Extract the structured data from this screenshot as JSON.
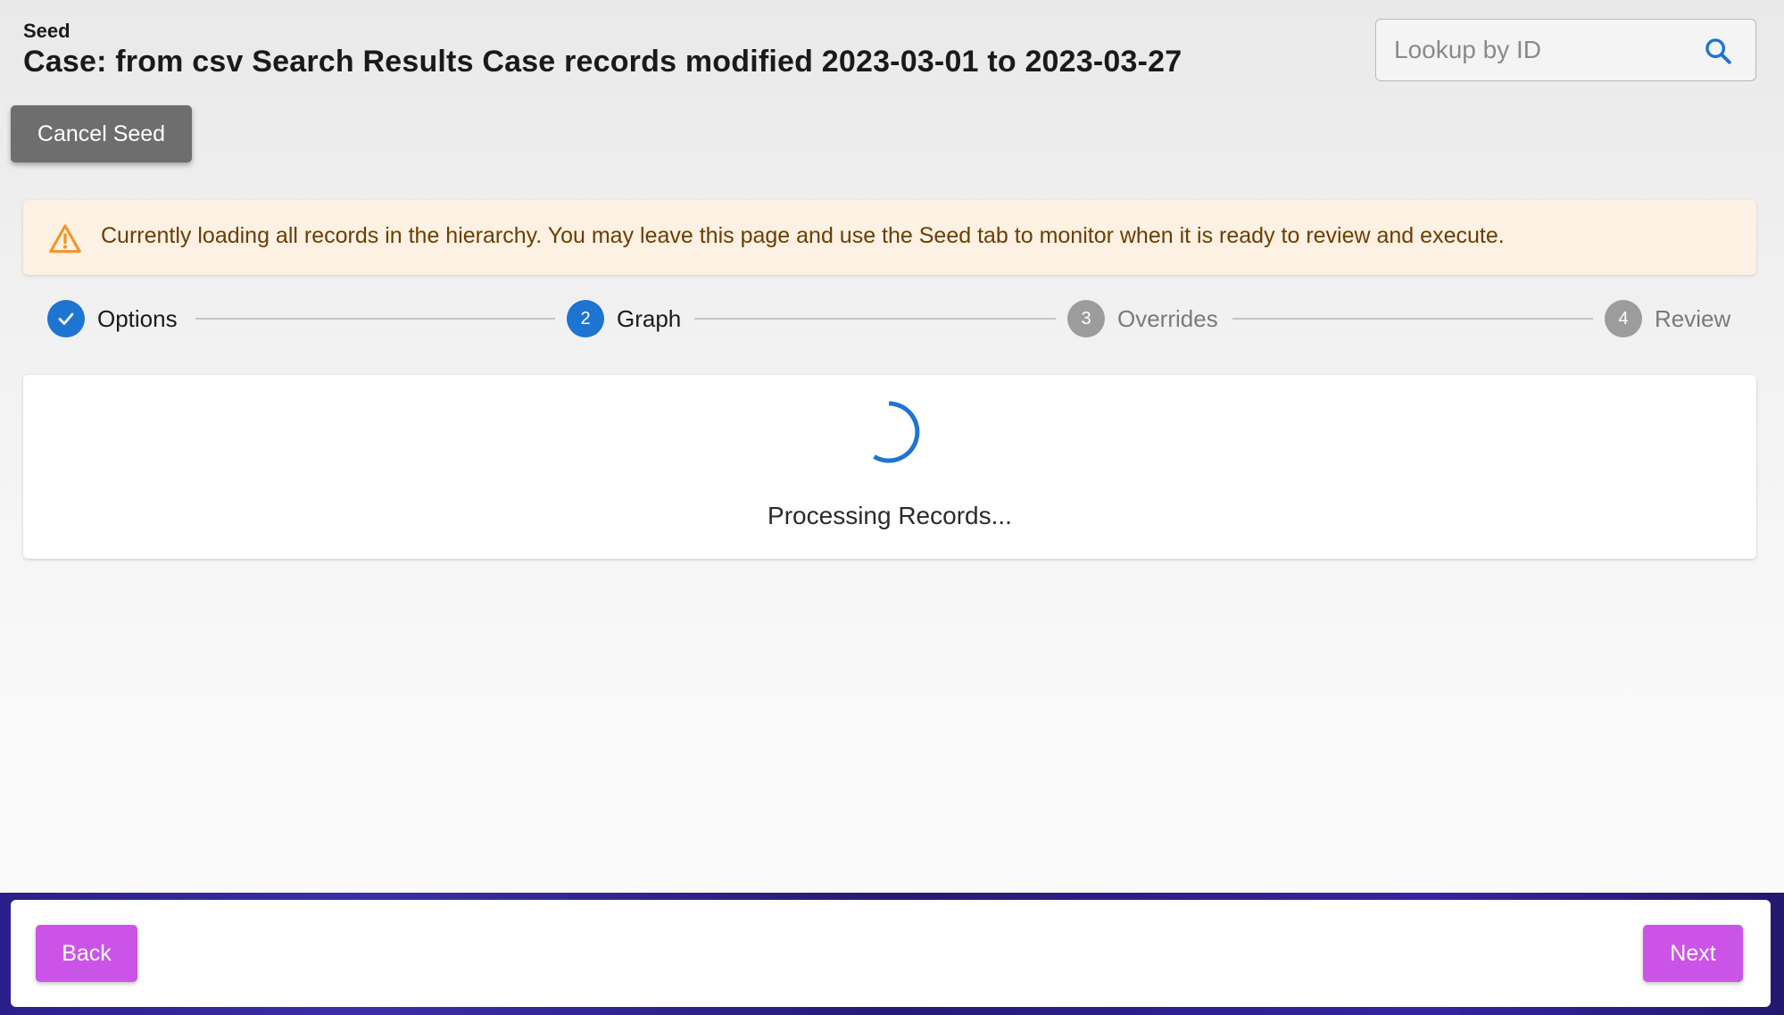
{
  "header": {
    "eyebrow": "Seed",
    "title": "Case: from csv Search Results Case records modified 2023-03-01 to 2023-03-27"
  },
  "search": {
    "placeholder": "Lookup by ID",
    "value": "",
    "icon": "search-icon"
  },
  "actions": {
    "cancel_label": "Cancel Seed"
  },
  "alert": {
    "icon": "warning-icon",
    "text": "Currently loading all records in the hierarchy. You may leave this page and use the Seed tab to monitor when it is ready to review and execute."
  },
  "stepper": {
    "steps": [
      {
        "label": "Options",
        "number": "1",
        "state": "completed"
      },
      {
        "label": "Graph",
        "number": "2",
        "state": "active"
      },
      {
        "label": "Overrides",
        "number": "3",
        "state": "pending"
      },
      {
        "label": "Review",
        "number": "4",
        "state": "pending"
      }
    ]
  },
  "content": {
    "status_text": "Processing Records..."
  },
  "footer": {
    "back_label": "Back",
    "next_label": "Next"
  },
  "colors": {
    "accent_blue": "#1e74d1",
    "button_purple": "#cc53e8",
    "cancel_gray": "#6e6e6e",
    "alert_bg": "#fdf1e3",
    "alert_text": "#6b3d00",
    "warning_orange": "#f0962a"
  }
}
